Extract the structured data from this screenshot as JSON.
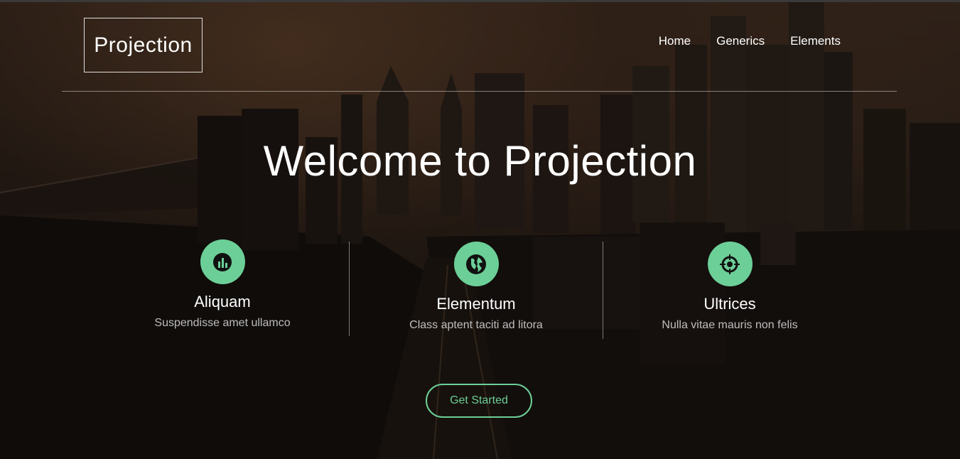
{
  "brand": {
    "logo_text": "Projection"
  },
  "nav": {
    "items": [
      {
        "label": "Home"
      },
      {
        "label": "Generics"
      },
      {
        "label": "Elements"
      }
    ]
  },
  "hero": {
    "headline": "Welcome to Projection"
  },
  "features": [
    {
      "icon": "bar-chart-icon",
      "title": "Aliquam",
      "description": "Suspendisse amet ullamco"
    },
    {
      "icon": "globe-icon",
      "title": "Elementum",
      "description": "Class aptent taciti ad litora"
    },
    {
      "icon": "target-icon",
      "title": "Ultrices",
      "description": "Nulla vitae mauris non felis"
    }
  ],
  "cta": {
    "label": "Get Started"
  },
  "colors": {
    "accent": "#6ccf97",
    "background": "#1a1512",
    "text": "#ffffff"
  }
}
